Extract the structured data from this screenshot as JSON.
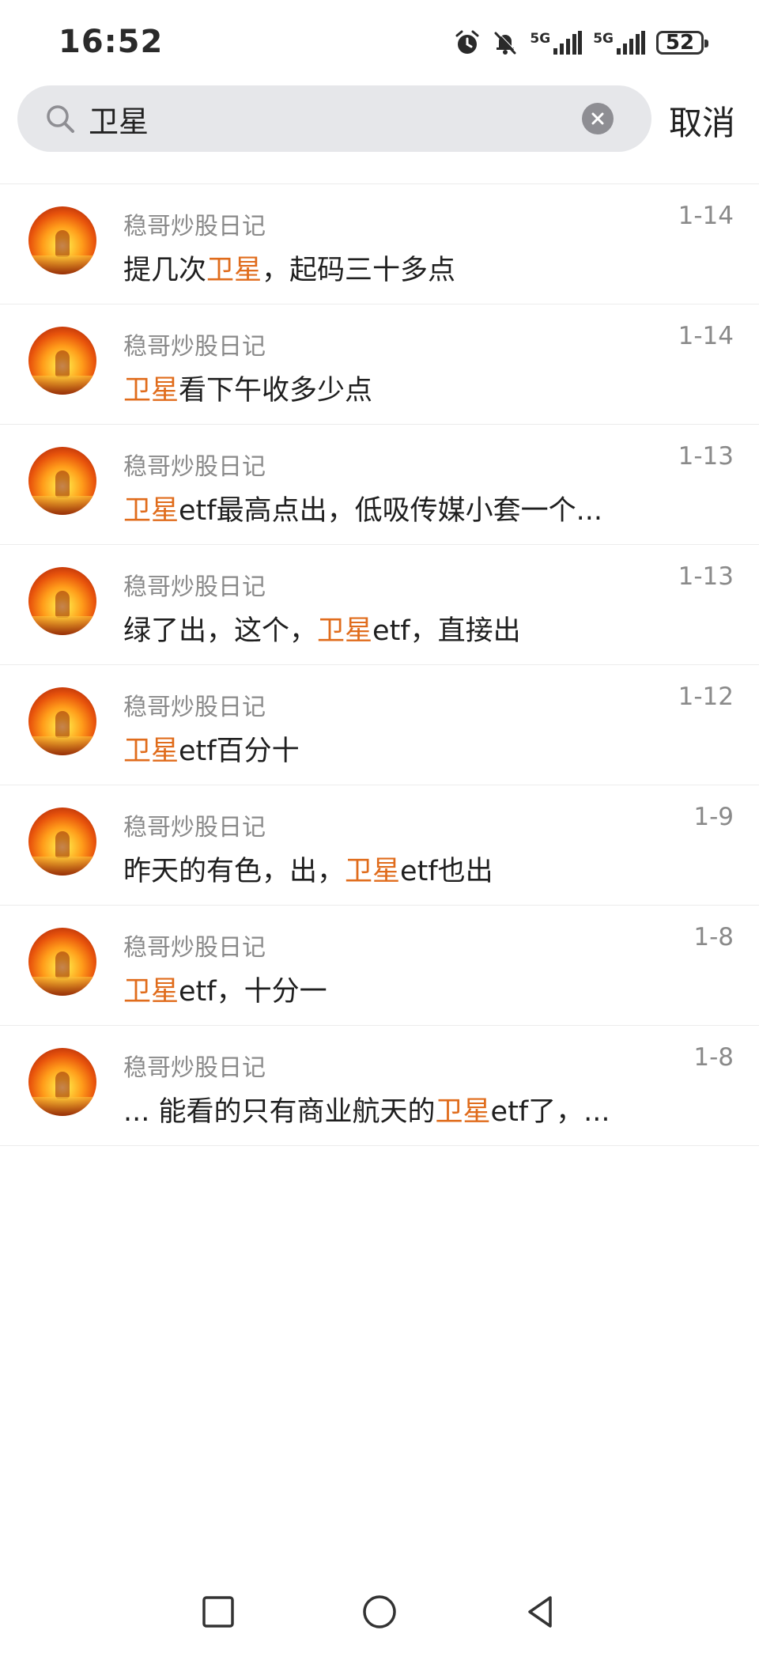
{
  "status_bar": {
    "time": "16:52",
    "network_1": "5G",
    "network_2": "5G",
    "battery": "52"
  },
  "search": {
    "query": "卫星",
    "cancel_label": "取消"
  },
  "highlight_color": "#e06c1c",
  "results": [
    {
      "author": "稳哥炒股日记",
      "date": "1-14",
      "segments": [
        {
          "t": "提几次",
          "hl": false
        },
        {
          "t": "卫星",
          "hl": true
        },
        {
          "t": "，起码三十多点",
          "hl": false
        }
      ]
    },
    {
      "author": "稳哥炒股日记",
      "date": "1-14",
      "segments": [
        {
          "t": "卫星",
          "hl": true
        },
        {
          "t": "看下午收多少点",
          "hl": false
        }
      ]
    },
    {
      "author": "稳哥炒股日记",
      "date": "1-13",
      "segments": [
        {
          "t": "卫星",
          "hl": true
        },
        {
          "t": "etf最高点出，低吸传媒小套一个...",
          "hl": false
        }
      ]
    },
    {
      "author": "稳哥炒股日记",
      "date": "1-13",
      "segments": [
        {
          "t": "绿了出，这个，",
          "hl": false
        },
        {
          "t": "卫星",
          "hl": true
        },
        {
          "t": "etf，直接出",
          "hl": false
        }
      ]
    },
    {
      "author": "稳哥炒股日记",
      "date": "1-12",
      "segments": [
        {
          "t": "卫星",
          "hl": true
        },
        {
          "t": "etf百分十",
          "hl": false
        }
      ]
    },
    {
      "author": "稳哥炒股日记",
      "date": "1-9",
      "segments": [
        {
          "t": "昨天的有色，出，",
          "hl": false
        },
        {
          "t": "卫星",
          "hl": true
        },
        {
          "t": "etf也出",
          "hl": false
        }
      ]
    },
    {
      "author": "稳哥炒股日记",
      "date": "1-8",
      "segments": [
        {
          "t": "卫星",
          "hl": true
        },
        {
          "t": "etf，十分一",
          "hl": false
        }
      ]
    },
    {
      "author": "稳哥炒股日记",
      "date": "1-8",
      "segments": [
        {
          "t": "... 能看的只有商业航天的",
          "hl": false
        },
        {
          "t": "卫星",
          "hl": true
        },
        {
          "t": "etf了，...",
          "hl": false
        }
      ]
    }
  ],
  "icons": {
    "status": [
      "alarm-icon",
      "mute-icon",
      "signal-icon",
      "signal-icon",
      "battery-icon"
    ],
    "search": "search-icon",
    "clear": "clear-icon",
    "nav": [
      "recent-apps-icon",
      "home-icon",
      "back-icon"
    ]
  }
}
